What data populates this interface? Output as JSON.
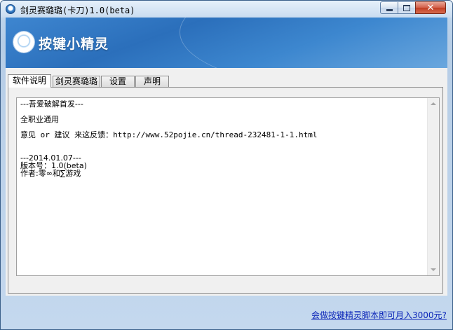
{
  "window": {
    "title": "剑灵赛璐璐(卡刀)1.0(beta)",
    "minimize_glyph": "",
    "maximize_glyph": "",
    "close_glyph": "✕"
  },
  "banner": {
    "logo_text": "按键小精灵"
  },
  "tabs": [
    {
      "label": "软件说明",
      "active": true
    },
    {
      "label": "剑灵赛璐璐",
      "active": false
    },
    {
      "label": "设置",
      "active": false
    },
    {
      "label": "声明",
      "active": false
    }
  ],
  "content": {
    "lines": {
      "l1": "---吾爱破解首发---",
      "l2": "全职业通用",
      "l3": "意见 or 建议 来这反馈：http://www.52pojie.cn/thread-232481-1-1.html",
      "l4": "---2014.01.07---",
      "l5": "版本号：1.0(beta)",
      "l6": "作者:零∞和∑游戏"
    }
  },
  "footer": {
    "link_text": "会做按键精灵脚本即可月入3000元?"
  },
  "colors": {
    "banner_blue": "#2b6fbb",
    "link_blue": "#0a24b8",
    "close_red": "#c23d22"
  }
}
